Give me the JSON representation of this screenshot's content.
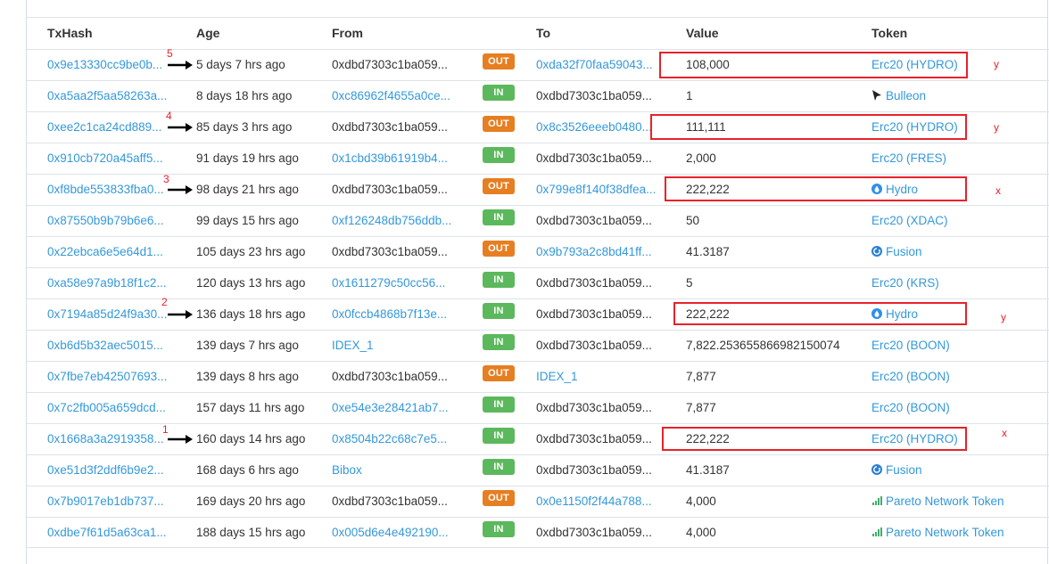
{
  "headers": {
    "txhash": "TxHash",
    "age": "Age",
    "from": "From",
    "to": "To",
    "value": "Value",
    "token": "Token"
  },
  "colors": {
    "link": "#3498db",
    "out": "#e67e22",
    "in": "#5cb85c",
    "annotation": "#e8212b"
  },
  "rows": [
    {
      "tx": "0x9e13330cc9be0b...",
      "age": "5 days 7 hrs ago",
      "from": "0xdbd7303c1ba059...",
      "dir": "OUT",
      "to": "0xda32f70faa59043...",
      "value": "108,000",
      "token": "Erc20 (HYDRO)",
      "token_icon": "none"
    },
    {
      "tx": "0xa5aa2f5aa58263a...",
      "age": "8 days 18 hrs ago",
      "from": "0xc86962f4655a0ce...",
      "dir": "IN",
      "to": "0xdbd7303c1ba059...",
      "value": "1",
      "token": "Bulleon",
      "token_icon": "bulleon-icon"
    },
    {
      "tx": "0xee2c1ca24cd889...",
      "age": "85 days 3 hrs ago",
      "from": "0xdbd7303c1ba059...",
      "dir": "OUT",
      "to": "0x8c3526eeeb0480...",
      "value": "111,111",
      "token": "Erc20 (HYDRO)",
      "token_icon": "none"
    },
    {
      "tx": "0x910cb720a45aff5...",
      "age": "91 days 19 hrs ago",
      "from": "0x1cbd39b61919b4...",
      "dir": "IN",
      "to": "0xdbd7303c1ba059...",
      "value": "2,000",
      "token": "Erc20 (FRES)",
      "token_icon": "none"
    },
    {
      "tx": "0xf8bde553833fba0...",
      "age": "98 days 21 hrs ago",
      "from": "0xdbd7303c1ba059...",
      "dir": "OUT",
      "to": "0x799e8f140f38dfea...",
      "value": "222,222",
      "token": "Hydro",
      "token_icon": "hydro-icon"
    },
    {
      "tx": "0x87550b9b79b6e6...",
      "age": "99 days 15 hrs ago",
      "from": "0xf126248db756ddb...",
      "dir": "IN",
      "to": "0xdbd7303c1ba059...",
      "value": "50",
      "token": "Erc20 (XDAC)",
      "token_icon": "none"
    },
    {
      "tx": "0x22ebca6e5e64d1...",
      "age": "105 days 23 hrs ago",
      "from": "0xdbd7303c1ba059...",
      "dir": "OUT",
      "to": "0x9b793a2c8bd41ff...",
      "value": "41.3187",
      "token": "Fusion",
      "token_icon": "fusion-icon"
    },
    {
      "tx": "0xa58e97a9b18f1c2...",
      "age": "120 days 13 hrs ago",
      "from": "0x1611279c50cc56...",
      "dir": "IN",
      "to": "0xdbd7303c1ba059...",
      "value": "5",
      "token": "Erc20 (KRS)",
      "token_icon": "none"
    },
    {
      "tx": "0x7194a85d24f9a30...",
      "age": "136 days 18 hrs ago",
      "from": "0x0fccb4868b7f13e...",
      "dir": "IN",
      "to": "0xdbd7303c1ba059...",
      "value": "222,222",
      "token": "Hydro",
      "token_icon": "hydro-icon"
    },
    {
      "tx": "0xb6d5b32aec5015...",
      "age": "139 days 7 hrs ago",
      "from": "IDEX_1",
      "dir": "IN",
      "to": "0xdbd7303c1ba059...",
      "value": "7,822.253655866982150074",
      "token": "Erc20 (BOON)",
      "token_icon": "none"
    },
    {
      "tx": "0x7fbe7eb42507693...",
      "age": "139 days 8 hrs ago",
      "from": "0xdbd7303c1ba059...",
      "dir": "OUT",
      "to": "IDEX_1",
      "value": "7,877",
      "token": "Erc20 (BOON)",
      "token_icon": "none"
    },
    {
      "tx": "0x7c2fb005a659dcd...",
      "age": "157 days 11 hrs ago",
      "from": "0xe54e3e28421ab7...",
      "dir": "IN",
      "to": "0xdbd7303c1ba059...",
      "value": "7,877",
      "token": "Erc20 (BOON)",
      "token_icon": "none"
    },
    {
      "tx": "0x1668a3a2919358...",
      "age": "160 days 14 hrs ago",
      "from": "0x8504b22c68c7e5...",
      "dir": "IN",
      "to": "0xdbd7303c1ba059...",
      "value": "222,222",
      "token": "Erc20 (HYDRO)",
      "token_icon": "none"
    },
    {
      "tx": "0xe51d3f2ddf6b9e2...",
      "age": "168 days 6 hrs ago",
      "from": "Bibox",
      "dir": "IN",
      "to": "0xdbd7303c1ba059...",
      "value": "41.3187",
      "token": "Fusion",
      "token_icon": "fusion-icon"
    },
    {
      "tx": "0x7b9017eb1db737...",
      "age": "169 days 20 hrs ago",
      "from": "0xdbd7303c1ba059...",
      "dir": "OUT",
      "to": "0x0e1150f2f44a788...",
      "value": "4,000",
      "token": "Pareto Network Token",
      "token_icon": "pareto-icon"
    },
    {
      "tx": "0xdbe7f61d5a63ca1...",
      "age": "188 days 15 hrs ago",
      "from": "0x005d6e4e492190...",
      "dir": "IN",
      "to": "0xdbd7303c1ba059...",
      "value": "4,000",
      "token": "Pareto Network Token",
      "token_icon": "pareto-icon"
    }
  ],
  "annotations": {
    "numbers": [
      "5",
      "4",
      "3",
      "2",
      "1"
    ],
    "marks": [
      "y",
      "y",
      "x",
      "y",
      "x"
    ]
  }
}
